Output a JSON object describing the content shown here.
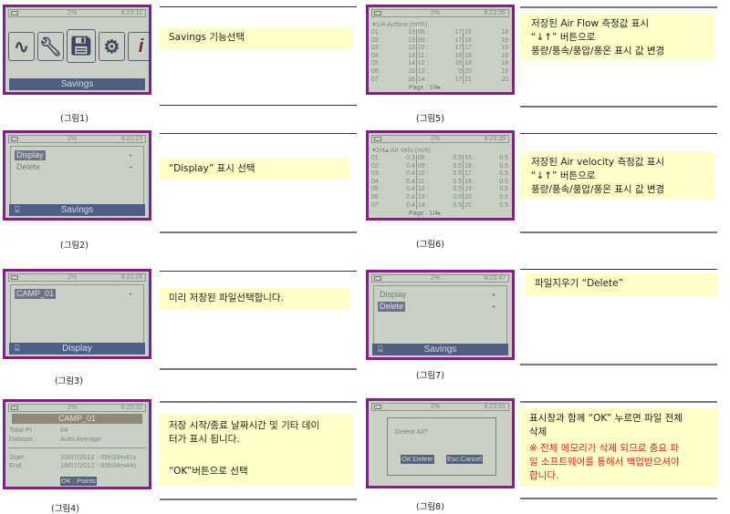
{
  "status": {
    "memory": "2%"
  },
  "figures": {
    "f1": {
      "caption": "(그림1)",
      "time": "8:23:12",
      "footer": "Savings",
      "note": [
        "Savings 기능선택"
      ],
      "icons": [
        "waveform-icon",
        "wrench-icon",
        "floppy-disk-icon",
        "gear-icon",
        "info-icon"
      ]
    },
    "f2": {
      "caption": "(그림2)",
      "time": "8:23:23",
      "footer": "Savings",
      "menu": [
        "Display",
        "Delete"
      ],
      "note": [
        "“Display” 표시 선택"
      ]
    },
    "f3": {
      "caption": "(그림3)",
      "time": "8:23:28",
      "footer": "Display",
      "menu": [
        "CAMP_01"
      ],
      "note": [
        "미리 저장된 파일선택합니다."
      ]
    },
    "f4": {
      "caption": "(그림4)",
      "time": "8:23:32",
      "title": "CAMP_01",
      "rows": [
        {
          "k": "Total Pt :",
          "v": "64"
        },
        {
          "k": "Dataset :",
          "v": "Auto Average"
        },
        {
          "k": "Start :",
          "v": "10/07/2012 - 05h33m41s"
        },
        {
          "k": "End :",
          "v": "18/07/2012 - 05h34m44s"
        }
      ],
      "ok": "OK : Points",
      "note": [
        "저장 시작/종료 날짜시간 및 기타 데이",
        "터가 표시 됩니다.",
        "“OK”버튼으로 선택"
      ]
    },
    "f5": {
      "caption": "(그림5)",
      "time": "8:23:36",
      "header": "▾1/4  Airflow (m³/h)",
      "page": "Page : 1/4▸",
      "labels": [
        "01 :",
        "02 :",
        "03 :",
        "04 :",
        "05 :",
        "06 :",
        "07 :",
        "08 :",
        "09 :",
        "10 :",
        "11 :",
        "12 :",
        "13 :",
        "14 :",
        "15 :",
        "16 :",
        "17 :",
        "18 :",
        "19 :",
        "20 :",
        "21 :"
      ],
      "values": [
        "13",
        "13",
        "13",
        "14",
        "14",
        "15",
        "16",
        "17",
        "17",
        "17",
        "18",
        "18",
        "0",
        "17",
        "18",
        "19",
        "19",
        "19",
        "19",
        "19",
        "20"
      ],
      "note": [
        "저장된 Air Flow 측정값 표시",
        "“↓↑” 버튼으로",
        "풍량/풍속/풍압/풍온 표시 값 변경"
      ]
    },
    "f6": {
      "caption": "(그림6)",
      "time": "8:23:39",
      "header": "▾2/4▴ Air velo (m/s)",
      "page": "Page : 1/4▸",
      "labels": [
        "01 :",
        "02 :",
        "03 :",
        "04 :",
        "05 :",
        "06 :",
        "07 :",
        "08 :",
        "09 :",
        "10 :",
        "11 :",
        "12 :",
        "13 :",
        "14 :",
        "15 :",
        "16 :",
        "17 :",
        "18 :",
        "19 :",
        "20 :",
        "21 :"
      ],
      "values": [
        "0.3",
        "0.4",
        "0.4",
        "0.4",
        "0.4",
        "0.4",
        "0.4",
        "0.5",
        "0.5",
        "0.5",
        "0.5",
        "0.5",
        "0.0",
        "0.5",
        "0.5",
        "0.5",
        "0.5",
        "0.5",
        "0.5",
        "0.5",
        "0.5"
      ],
      "note": [
        "저장된 Air velocity 측정값 표시",
        "“↓↑” 버튼으로",
        "풍량/풍속/풍압/풍온 표시 값 변경"
      ]
    },
    "f7": {
      "caption": "(그림7)",
      "time": "8:23:47",
      "footer": "Savings",
      "menu": [
        "Display",
        "Delete"
      ],
      "note": [
        "파일지우기 “Delete”"
      ]
    },
    "f8": {
      "caption": "(그림8)",
      "time": "8:23:51",
      "question": "Delete All?",
      "ok": "OK:Delete",
      "esc": "Esc:Cancel",
      "note": [
        "표시창과 함께 “OK” 누르면 파일 전체",
        "삭제"
      ],
      "warning": [
        "※  전체 메모리가 삭제 되므로 중요 파",
        "일 소프트웨어를 통해서 백업받으셔야",
        "합니다."
      ]
    }
  },
  "colors": {
    "frame": "#8a1c8a",
    "note_bg": "#ffffc8",
    "warning": "#e02020"
  }
}
